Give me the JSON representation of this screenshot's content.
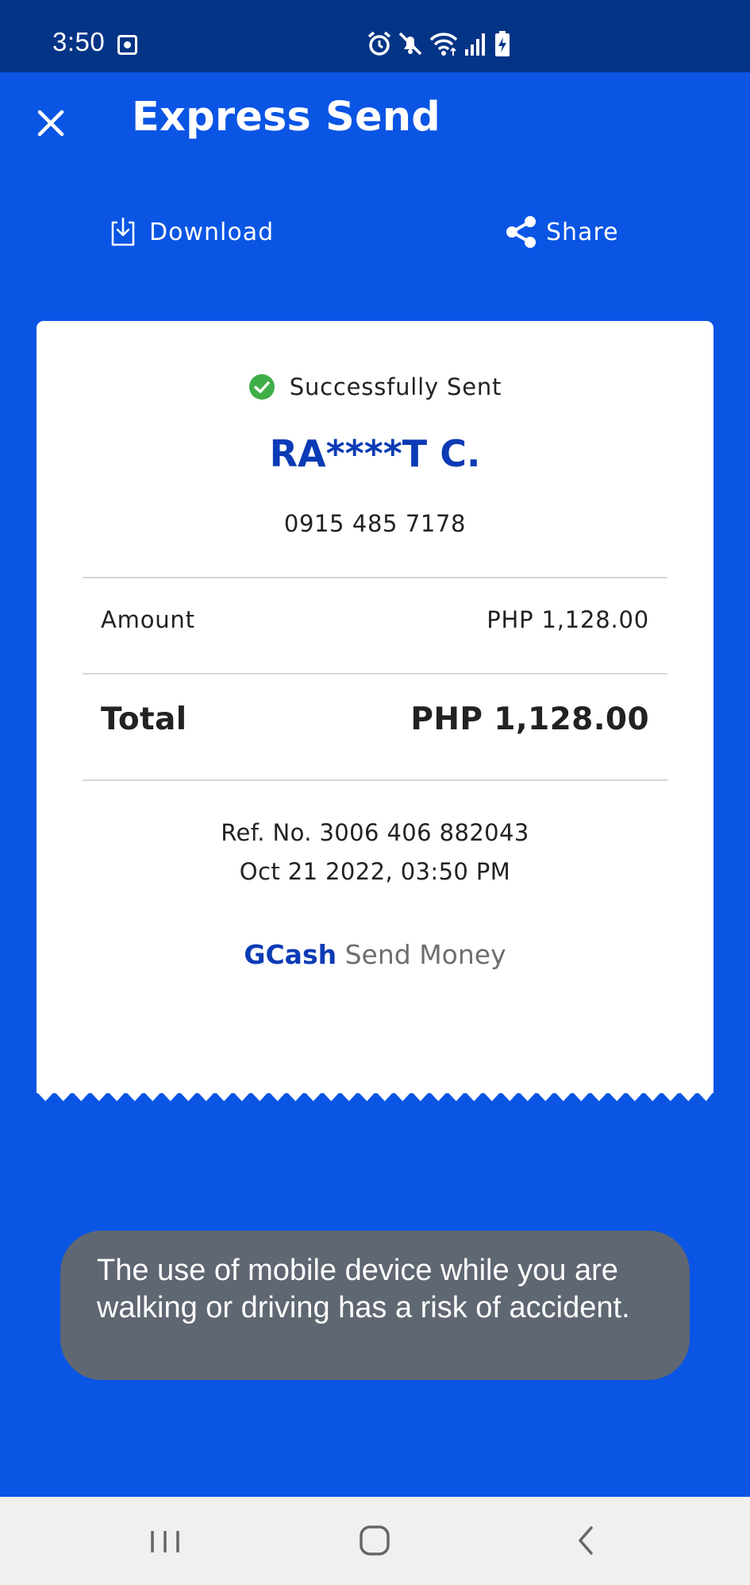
{
  "status_bar": {
    "time": "3:50",
    "icons": [
      "screen-recorder-icon",
      "alarm-icon",
      "mute-icon",
      "wifi-icon",
      "signal-icon",
      "battery-charging-icon"
    ]
  },
  "app_bar": {
    "title": "Express Send",
    "close_icon": "close-icon"
  },
  "actions": {
    "download_label": "Download",
    "share_label": "Share"
  },
  "receipt": {
    "status": "Successfully Sent",
    "recipient_name": "RA****T C.",
    "recipient_number": "0915 485 7178",
    "amount_label": "Amount",
    "amount_value": "PHP 1,128.00",
    "total_label": "Total",
    "total_value": "PHP 1,128.00",
    "ref_no": "Ref. No. 3006 406 882043",
    "date": "Oct 21 2022, 03:50 PM",
    "brand": "GCash",
    "brand_label": "Send Money"
  },
  "toast": {
    "message": "The use of mobile device while you are walking or driving has a risk of accident."
  },
  "nav_bar": {
    "buttons": [
      "recent-apps-icon",
      "home-icon",
      "back-icon"
    ]
  },
  "colors": {
    "primary": "#0a55e4",
    "status_bar": "#043486",
    "accent_text": "#0b3bb5",
    "success": "#3fae49",
    "toast_bg": "#5f6772"
  }
}
